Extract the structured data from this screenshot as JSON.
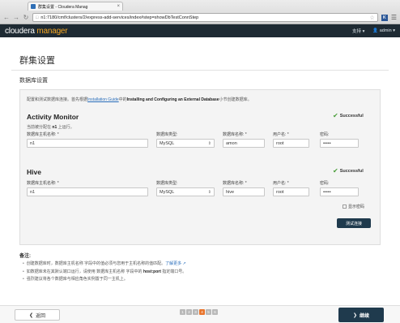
{
  "browser": {
    "tab_title": "群集设置 - Cloudera Manag",
    "tab_close": "×",
    "url": "n1:7180/cmf/clusters/2/express-add-services/index#step=showDbTestConnStep",
    "extension_label": "K",
    "icons": [
      "back-icon",
      "forward-icon",
      "reload-icon",
      "star-icon",
      "menu-icon"
    ]
  },
  "app": {
    "logo_part1": "cloudera",
    "logo_part2": "manager",
    "support_label": "支持 ▾",
    "user_label": "👤 admin ▾"
  },
  "page": {
    "title": "群集设置",
    "section_title": "数据库设置",
    "intro_before": "配置和测试数据库连接。首先根据",
    "intro_link": "Installation Guide",
    "intro_mid": "中的",
    "intro_bold": "Installing and Configuring an External Database",
    "intro_after": "小节创建数据库。"
  },
  "activity_monitor": {
    "title": "Activity Monitor",
    "status": "Successful",
    "run_note_before": "当前被分配在",
    "run_note_host": "n1",
    "run_note_after": "上运行。",
    "host_label": "数据库主机名称: *",
    "host_value": "n1",
    "type_label": "数据库类型:",
    "type_value": "MySQL",
    "name_label": "数据库名称: *",
    "name_value": "amon",
    "user_label": "用户名: *",
    "user_value": "root",
    "password_label": "密码:",
    "password_value": "•••••"
  },
  "hive": {
    "title": "Hive",
    "status": "Successful",
    "host_label": "数据库主机名称: *",
    "host_value": "n1",
    "type_label": "数据库类型:",
    "type_value": "MySQL",
    "name_label": "数据库名称: *",
    "name_value": "hive",
    "user_label": "用户名: *",
    "user_value": "root",
    "password_label": "密码:",
    "password_value": "•••••"
  },
  "show_password_label": "显示密码",
  "test_button_label": "测试连接",
  "notes": {
    "title": "备注:",
    "item1_before": "创建数据库时，数据库主机名称 字段中的值必须与您用于主机名称的值匹配。",
    "item1_link": "了解更多 ↗",
    "item2_before": "如数据库未在其默认端口运行，请使用 数据库主机名称 字段中的",
    "item2_bold": "host:port",
    "item2_after": "指定端口号。",
    "item3": "强烈建议将各个数据库与相应角色实例置于同一主机上。"
  },
  "footer": {
    "back_label": "返回",
    "continue_label": "继续",
    "steps": [
      "1",
      "2",
      "3",
      "4",
      "5",
      "6"
    ],
    "active_step_index": 3
  },
  "colors": {
    "header_bg": "#1e2a33",
    "accent_orange": "#f5a623",
    "success_green": "#4a9e3a",
    "primary_button": "#1f3a4d",
    "link_blue": "#2a6ebb",
    "active_step": "#e8742c"
  }
}
